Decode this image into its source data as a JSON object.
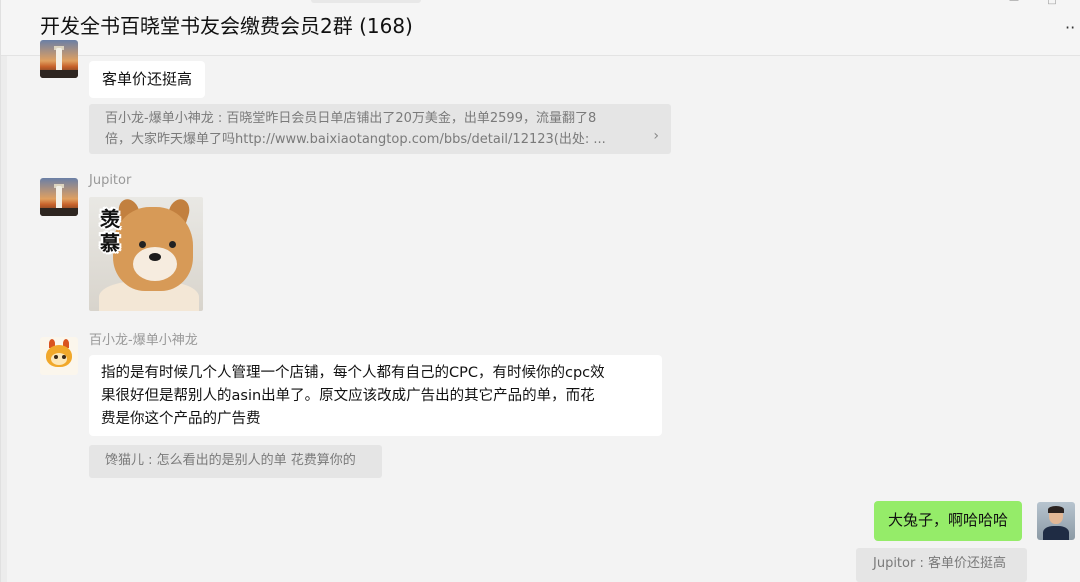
{
  "header": {
    "title": "开发全书百晓堂书友会缴费会员2群 (168)",
    "window_controls": [
      "pin-icon",
      "minimize-icon",
      "maximize-icon"
    ],
    "more_icon": "more-dots-icon"
  },
  "messages": [
    {
      "sender": "",
      "avatar": "sunset-lighthouse",
      "text": "客单价还挺高",
      "quote": {
        "line1": "百小龙-爆单小神龙 : 百晓堂昨日会员日单店铺出了20万美金，出单2599，流量翻了8",
        "line2": "倍，大家昨天爆单了吗http://www.baixiaotangtop.com/bbs/detail/12123(出处: ...",
        "arrow_icon": "chevron-right-icon"
      }
    },
    {
      "sender": "Jupitor",
      "avatar": "sunset-lighthouse",
      "sticker": {
        "text": "羡慕",
        "subject": "shiba-dog"
      }
    },
    {
      "sender": "百小龙-爆单小神龙",
      "avatar": "dragon-mascot",
      "lines": [
        "指的是有时候几个人管理一个店铺，每个人都有自己的CPC，有时候你的cpc效",
        "果很好但是帮别人的asin出单了。原文应该改成广告出的其它产品的单，而花",
        "费是你这个产品的广告费"
      ],
      "quote": {
        "text": "馋猫儿 : 怎么看出的是别人的单 花费算你的"
      }
    },
    {
      "sender": "self",
      "avatar": "person-photo",
      "text": "大兔子，啊哈哈哈",
      "quote": {
        "text": "Jupitor : 客单价还挺高"
      }
    }
  ],
  "colors": {
    "background": "#f3f3f3",
    "bubble_in": "#ffffff",
    "bubble_out": "#95ec69",
    "quote_bg": "#e5e5e5"
  }
}
